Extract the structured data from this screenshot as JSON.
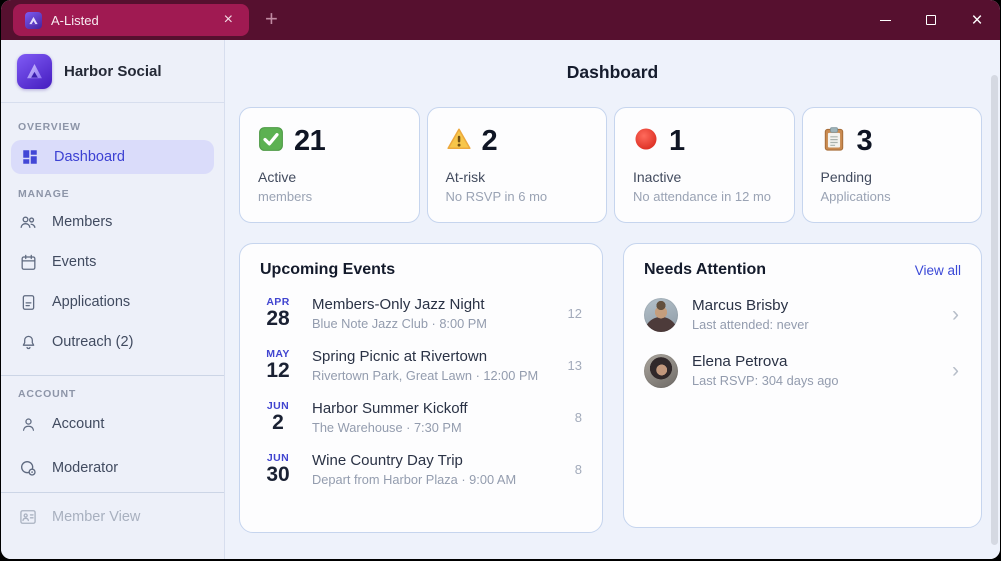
{
  "colors": {
    "titlebar": "#56102f",
    "tab_active": "#a01a52",
    "accent_indigo": "#3c41d3",
    "active_pill": "#dadcfa",
    "link_blue": "#3a48d7",
    "status_green": "#5cb152",
    "status_yellow": "#f7c64a",
    "status_red": "#ea392d",
    "card_border": "#c6d5ee"
  },
  "window": {
    "tab_title": "A-Listed",
    "tab_close_glyph": "×",
    "new_tab_glyph": "+",
    "close_glyph": "×"
  },
  "sidebar": {
    "brand": "Harbor Social",
    "sections": [
      {
        "label": "OVERVIEW",
        "items": [
          {
            "label": "Dashboard"
          }
        ]
      },
      {
        "label": "MANAGE",
        "items": [
          {
            "label": "Members"
          },
          {
            "label": "Events"
          },
          {
            "label": "Applications"
          },
          {
            "label": "Outreach (2)"
          }
        ]
      },
      {
        "label": "ACCOUNT",
        "items": [
          {
            "label": "Account"
          },
          {
            "label": "Moderator"
          }
        ]
      },
      {
        "label": "",
        "items": [
          {
            "label": "Member View"
          }
        ]
      }
    ]
  },
  "main": {
    "title": "Dashboard",
    "stats": [
      {
        "icon": "green-check",
        "value": "21",
        "label": "Active",
        "sub": "members"
      },
      {
        "icon": "warning-triangle",
        "value": "2",
        "label": "At-risk",
        "sub": "No RSVP in 6 mo"
      },
      {
        "icon": "red-circle",
        "value": "1",
        "label": "Inactive",
        "sub": "No attendance in 12 mo"
      },
      {
        "icon": "clipboard",
        "value": "3",
        "label": "Pending",
        "sub": "Applications"
      }
    ],
    "upcoming": {
      "title": "Upcoming Events",
      "events": [
        {
          "month": "APR",
          "day": "28",
          "title": "Members-Only Jazz Night",
          "detail": "Blue Note Jazz Club · 8:00 PM",
          "count": "12"
        },
        {
          "month": "MAY",
          "day": "12",
          "title": "Spring Picnic at Rivertown",
          "detail": "Rivertown Park, Great Lawn · 12:00 PM",
          "count": "13"
        },
        {
          "month": "JUN",
          "day": "2",
          "title": "Harbor Summer Kickoff",
          "detail": "The Warehouse · 7:30 PM",
          "count": "8"
        },
        {
          "month": "JUN",
          "day": "30",
          "title": "Wine Country Day Trip",
          "detail": "Depart from Harbor Plaza · 9:00 AM",
          "count": "8"
        }
      ]
    },
    "attention": {
      "title": "Needs Attention",
      "view_all": "View all",
      "chevron_glyph": "›",
      "people": [
        {
          "name": "Marcus Brisby",
          "sub": "Last attended: never"
        },
        {
          "name": "Elena Petrova",
          "sub": "Last RSVP: 304 days ago"
        }
      ]
    }
  }
}
